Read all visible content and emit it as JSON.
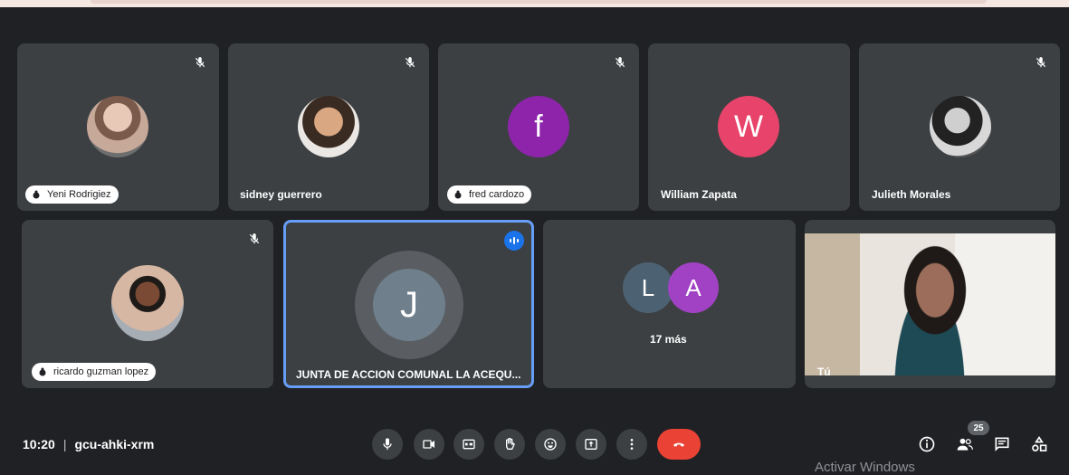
{
  "tiles": [
    {
      "name": "Yeni Rodrigiez"
    },
    {
      "name": "sidney guerrero"
    },
    {
      "name": "fred cardozo",
      "initial": "f"
    },
    {
      "name": "William Zapata",
      "initial": "W"
    },
    {
      "name": "Julieth Morales"
    },
    {
      "name": "ricardo guzman lopez"
    },
    {
      "name": "JUNTA DE ACCION COMUNAL LA ACEQU...",
      "initial": "J"
    },
    {
      "initials": [
        "L",
        "A"
      ],
      "more": "17 más"
    },
    {
      "name": "Tú"
    }
  ],
  "colors": {
    "fred_avatar": "#8e24aa",
    "william_avatar": "#e8436a",
    "junta_avatar": "#6f7f8c",
    "l_avatar": "#4c6272",
    "a_avatar": "#a142c4",
    "end_call": "#ea4335",
    "speaking_border": "#669df6"
  },
  "meeting": {
    "time": "10:20",
    "separator": "|",
    "code": "gcu-ahki-xrm"
  },
  "controls": [
    "mic-icon",
    "camera-icon",
    "captions-icon",
    "raise-hand-icon",
    "emoji-icon",
    "present-icon",
    "more-options-icon",
    "end-call-icon"
  ],
  "side_controls": {
    "people_count": "25",
    "icons": [
      "info-icon",
      "people-icon",
      "chat-icon",
      "activities-icon"
    ]
  },
  "watermark": "Activar Windows"
}
